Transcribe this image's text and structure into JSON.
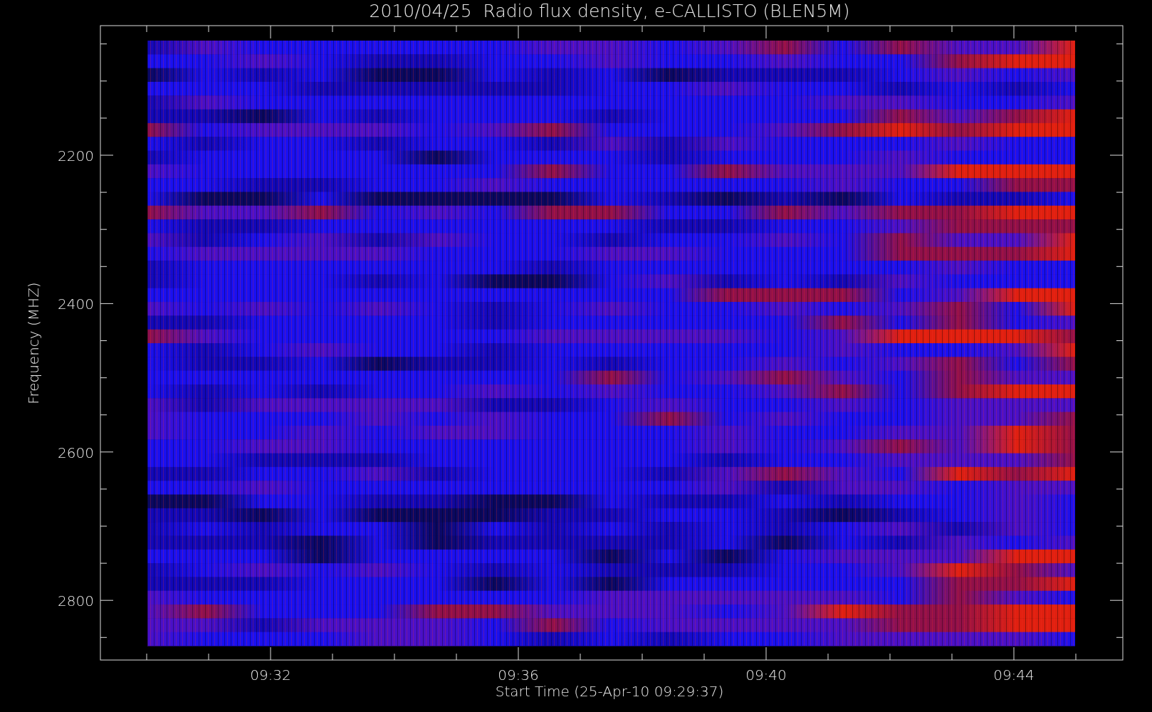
{
  "title": "2010/04/25  Radio flux density, e-CALLISTO (BLEN5M)",
  "x_axis": {
    "label": "Start Time (25-Apr-10 09:29:37)",
    "ticks": [
      "09:32",
      "09:36",
      "09:40",
      "09:44"
    ]
  },
  "y_axis": {
    "label": "Frequency (MHZ)",
    "ticks": [
      "2200",
      "2400",
      "2600",
      "2800"
    ]
  }
}
